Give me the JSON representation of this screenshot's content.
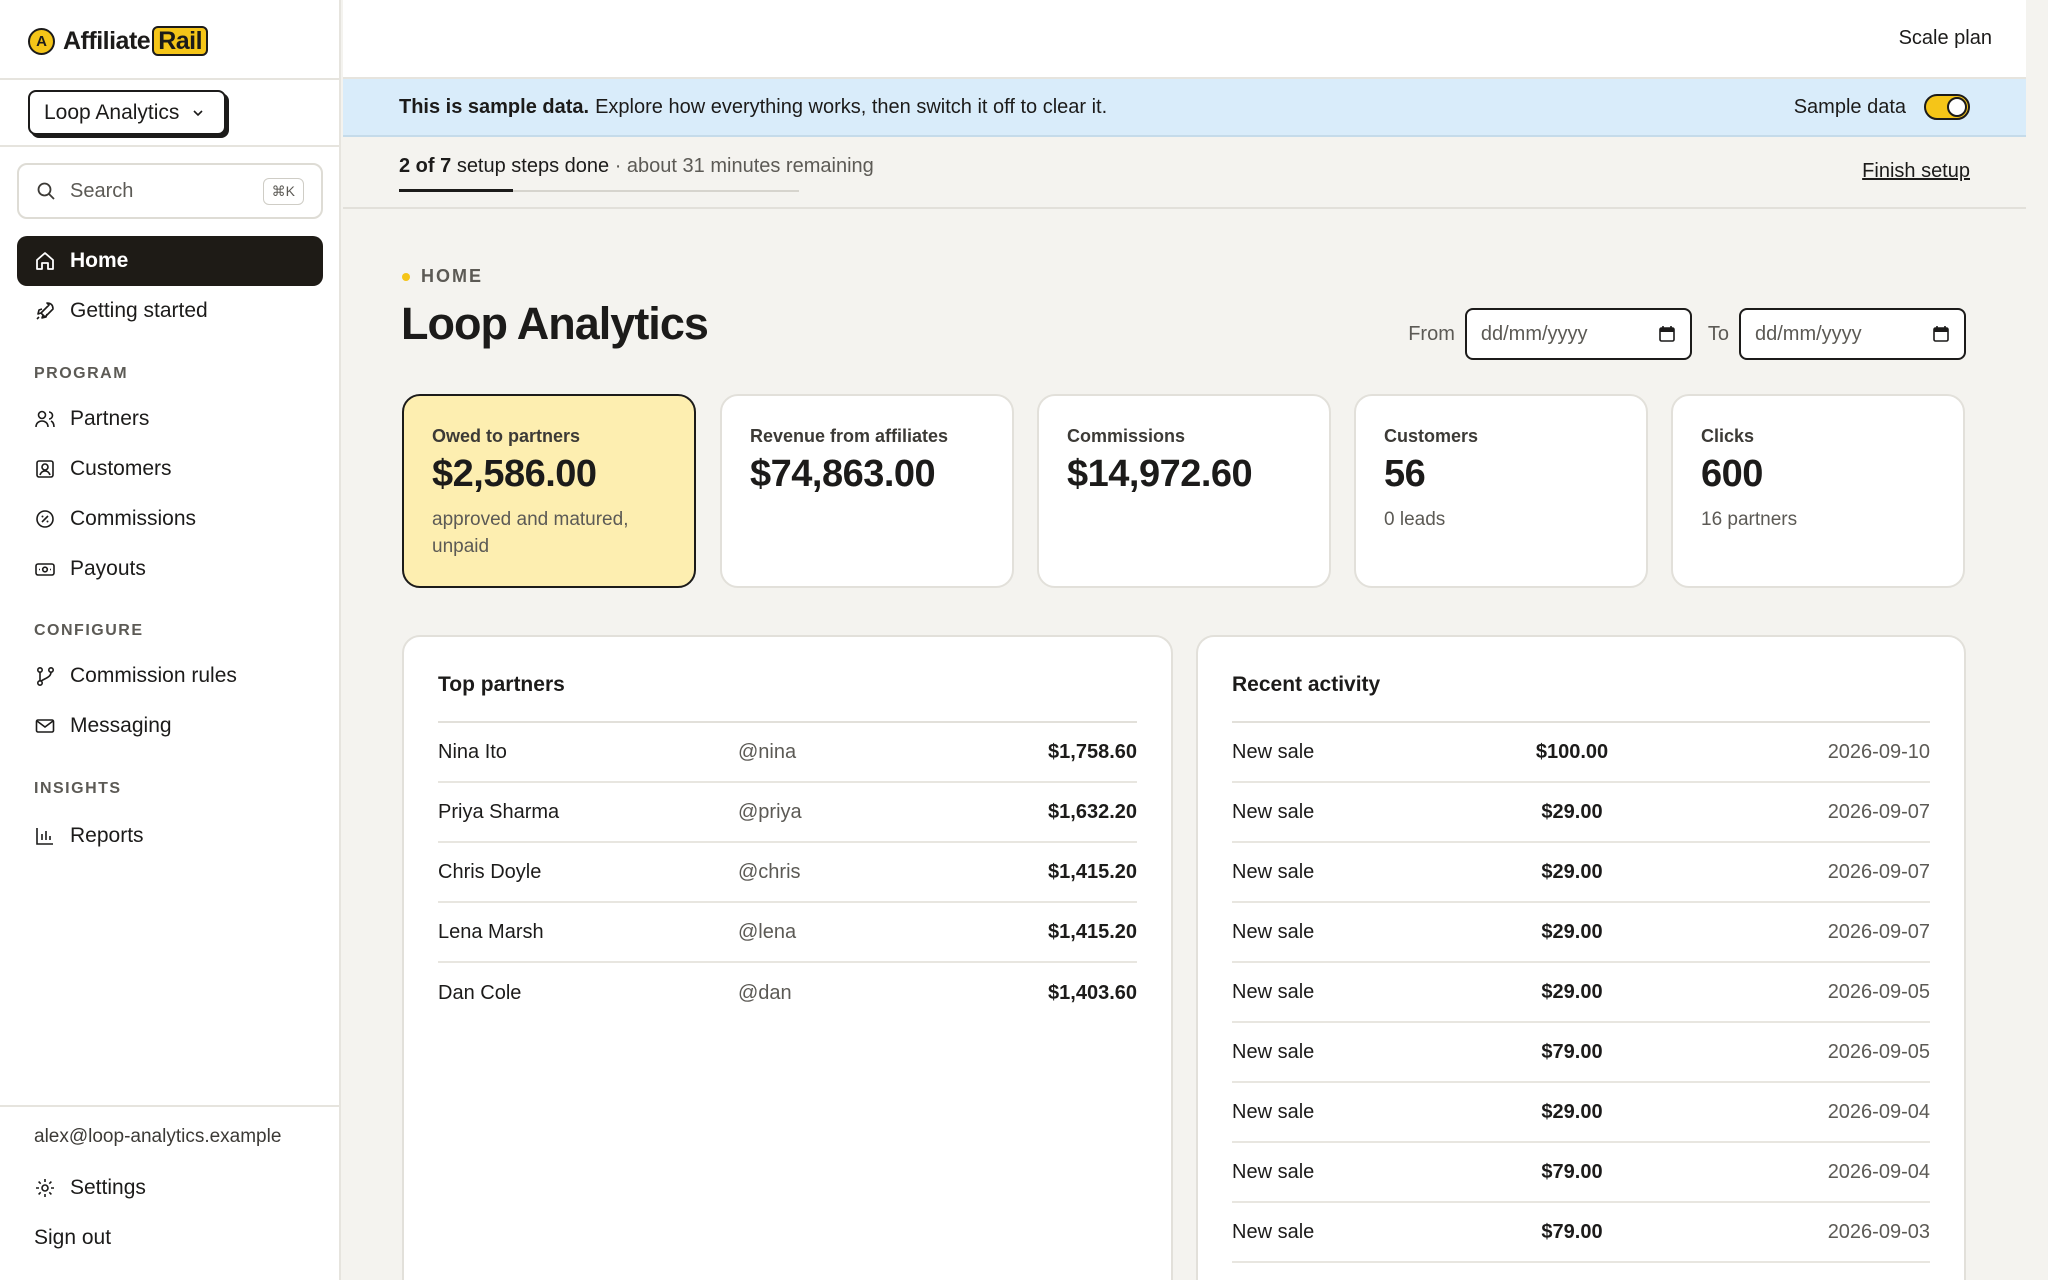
{
  "app": {
    "logo_prefix": "Affiliate",
    "logo_suffix": "Rail",
    "logo_mark": "A"
  },
  "org_switcher": {
    "label": "Loop Analytics"
  },
  "search": {
    "placeholder": "Search",
    "shortcut": "⌘K"
  },
  "nav": {
    "home": "Home",
    "getting_started": "Getting started",
    "sections": {
      "program": "PROGRAM",
      "configure": "CONFIGURE",
      "insights": "INSIGHTS"
    },
    "partners": "Partners",
    "customers": "Customers",
    "commissions": "Commissions",
    "payouts": "Payouts",
    "commission_rules": "Commission rules",
    "messaging": "Messaging",
    "reports": "Reports",
    "settings": "Settings",
    "sign_out": "Sign out"
  },
  "user": {
    "email": "alex@loop-analytics.example"
  },
  "topbar": {
    "plan": "Scale plan"
  },
  "banner": {
    "bold": "This is sample data.",
    "text": "Explore how everything works, then switch it off to clear it.",
    "toggle_label": "Sample data",
    "toggle_on": true
  },
  "setup": {
    "done": "2 of 7",
    "done_suffix": "setup steps done",
    "remaining": "· about 31 minutes remaining",
    "finish": "Finish setup",
    "progress": 0.2857
  },
  "page": {
    "crumb": "HOME",
    "title": "Loop Analytics"
  },
  "filters": {
    "from_label": "From",
    "to_label": "To",
    "from_placeholder": "dd/mm/yyyy",
    "to_placeholder": "dd/mm/yyyy"
  },
  "stats": [
    {
      "label": "Owed to partners",
      "value": "$2,586.00",
      "sub": "approved and matured, unpaid"
    },
    {
      "label": "Revenue from affiliates",
      "value": "$74,863.00",
      "sub": ""
    },
    {
      "label": "Commissions",
      "value": "$14,972.60",
      "sub": ""
    },
    {
      "label": "Customers",
      "value": "56",
      "sub": "0 leads"
    },
    {
      "label": "Clicks",
      "value": "600",
      "sub": "16 partners"
    }
  ],
  "top_partners": {
    "title": "Top partners",
    "rows": [
      {
        "name": "Nina Ito",
        "handle": "@nina",
        "amount": "$1,758.60"
      },
      {
        "name": "Priya Sharma",
        "handle": "@priya",
        "amount": "$1,632.20"
      },
      {
        "name": "Chris Doyle",
        "handle": "@chris",
        "amount": "$1,415.20"
      },
      {
        "name": "Lena Marsh",
        "handle": "@lena",
        "amount": "$1,415.20"
      },
      {
        "name": "Dan Cole",
        "handle": "@dan",
        "amount": "$1,403.60"
      }
    ]
  },
  "recent_activity": {
    "title": "Recent activity",
    "rows": [
      {
        "type": "New sale",
        "amount": "$100.00",
        "date": "2026-09-10"
      },
      {
        "type": "New sale",
        "amount": "$29.00",
        "date": "2026-09-07"
      },
      {
        "type": "New sale",
        "amount": "$29.00",
        "date": "2026-09-07"
      },
      {
        "type": "New sale",
        "amount": "$29.00",
        "date": "2026-09-07"
      },
      {
        "type": "New sale",
        "amount": "$29.00",
        "date": "2026-09-05"
      },
      {
        "type": "New sale",
        "amount": "$79.00",
        "date": "2026-09-05"
      },
      {
        "type": "New sale",
        "amount": "$29.00",
        "date": "2026-09-04"
      },
      {
        "type": "New sale",
        "amount": "$79.00",
        "date": "2026-09-04"
      },
      {
        "type": "New sale",
        "amount": "$79.00",
        "date": "2026-09-03"
      }
    ]
  }
}
